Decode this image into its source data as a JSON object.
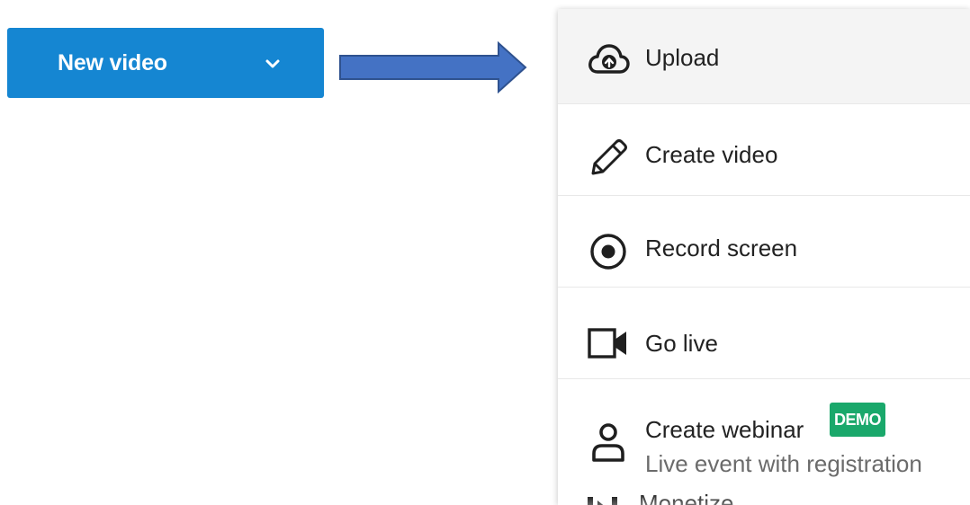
{
  "button": {
    "label": "New video",
    "color": "#1586d2",
    "icon": "chevron-down-icon"
  },
  "annotation": {
    "arrow_color": "#4472c4",
    "icon": "right-arrow-icon"
  },
  "menu": {
    "items": [
      {
        "label": "Upload",
        "icon": "cloud-upload-icon",
        "hovered": true
      },
      {
        "label": "Create video",
        "icon": "pencil-icon"
      },
      {
        "label": "Record screen",
        "icon": "record-icon"
      },
      {
        "label": "Go live",
        "icon": "video-camera-icon"
      },
      {
        "label": "Create webinar",
        "badge": "DEMO",
        "subtitle": "Live event with registration",
        "icon": "person-icon"
      },
      {
        "label": "Monetize",
        "icon": "monetize-icon"
      }
    ],
    "badge_color": "#1aa86b"
  }
}
